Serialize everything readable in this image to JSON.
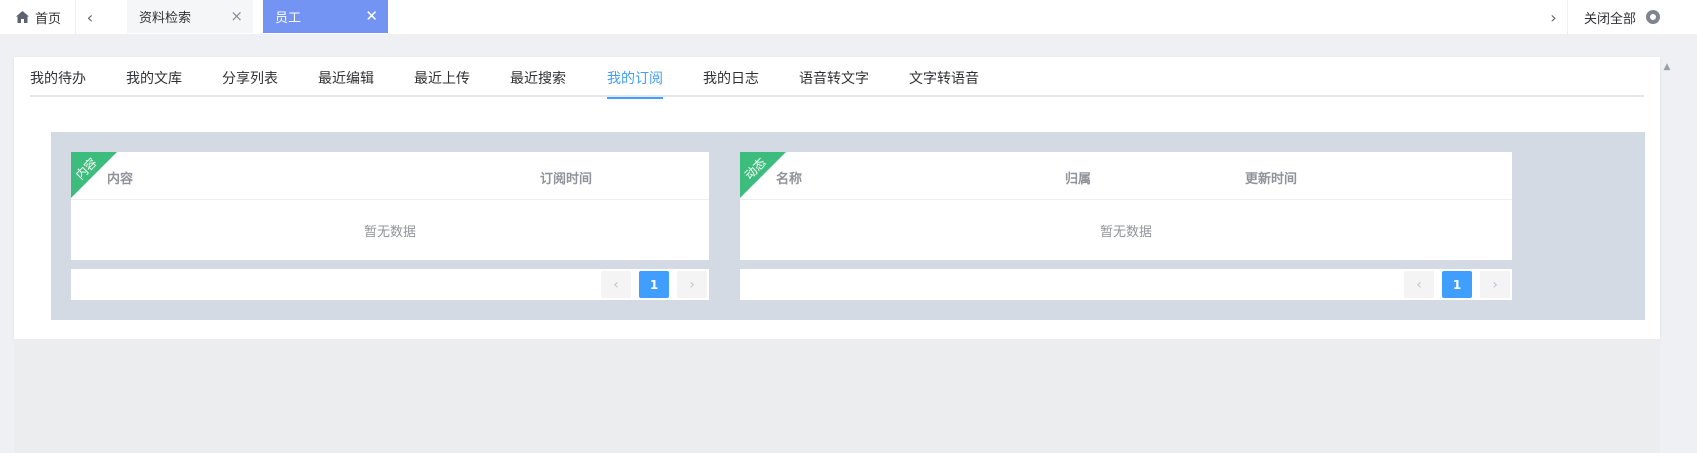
{
  "topbar": {
    "home_label": "首页",
    "tabs": [
      {
        "label": "资料检索",
        "close": "×",
        "active": false
      },
      {
        "label": "员工",
        "close": "✕",
        "active": true
      }
    ],
    "close_all_label": "关闭全部",
    "prev_glyph": "‹",
    "next_glyph": "›"
  },
  "subtabs": {
    "items": [
      "我的待办",
      "我的文库",
      "分享列表",
      "最近编辑",
      "最近上传",
      "最近搜索",
      "我的订阅",
      "我的日志",
      "语音转文字",
      "文字转语音"
    ],
    "active": "我的订阅"
  },
  "left_table": {
    "ribbon": "内容",
    "columns": [
      "内容",
      "订阅时间"
    ],
    "empty_text": "暂无数据",
    "pagination": {
      "prev": "‹",
      "current_page": "1",
      "next": "›"
    }
  },
  "right_table": {
    "ribbon": "动态",
    "columns": [
      "名称",
      "归属",
      "更新时间"
    ],
    "empty_text": "暂无数据",
    "pagination": {
      "prev": "‹",
      "current_page": "1",
      "next": "›"
    }
  },
  "colors": {
    "accent": "#409eff",
    "active_tab": "#7394f2",
    "ribbon": "#3dbd7d",
    "panel_bg": "#d3dae4"
  },
  "icons": [
    "home-icon",
    "chevron-left-icon",
    "close-icon",
    "chevron-right-icon",
    "gear-icon",
    "scroll-up-icon"
  ]
}
